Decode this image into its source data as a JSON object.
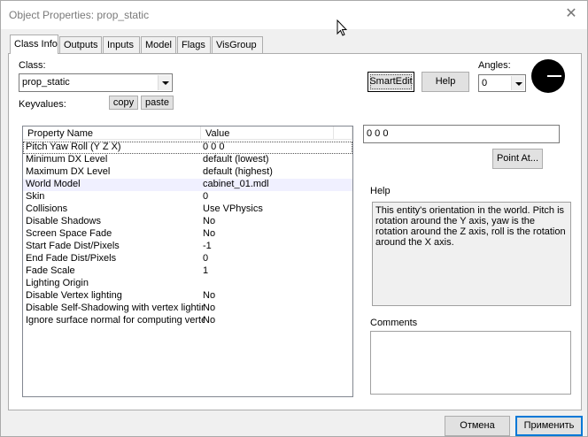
{
  "window": {
    "title": "Object Properties: prop_static",
    "close_glyph": "✕"
  },
  "tabs": [
    {
      "label": "Class Info",
      "active": true
    },
    {
      "label": "Outputs"
    },
    {
      "label": "Inputs"
    },
    {
      "label": "Model"
    },
    {
      "label": "Flags"
    },
    {
      "label": "VisGroup"
    }
  ],
  "class_info": {
    "class_label": "Class:",
    "class_value": "prop_static",
    "keyvalues_label": "Keyvalues:",
    "copy_label": "copy",
    "paste_label": "paste",
    "smartedit_label": "SmartEdit",
    "help_label": "Help",
    "angles_label": "Angles:",
    "angles_value": "0",
    "columns": [
      "Property Name",
      "Value"
    ],
    "properties": [
      {
        "name": "Pitch Yaw Roll (Y Z X)",
        "value": "0 0 0"
      },
      {
        "name": "Minimum DX Level",
        "value": "default (lowest)"
      },
      {
        "name": "Maximum DX Level",
        "value": "default (highest)"
      },
      {
        "name": "World Model",
        "value": "cabinet_01.mdl"
      },
      {
        "name": "Skin",
        "value": "0"
      },
      {
        "name": "Collisions",
        "value": "Use VPhysics"
      },
      {
        "name": "Disable Shadows",
        "value": "No"
      },
      {
        "name": "Screen Space Fade",
        "value": "No"
      },
      {
        "name": "Start Fade Dist/Pixels",
        "value": "-1"
      },
      {
        "name": "End Fade Dist/Pixels",
        "value": "0"
      },
      {
        "name": "Fade Scale",
        "value": "1"
      },
      {
        "name": "Lighting Origin",
        "value": ""
      },
      {
        "name": "Disable Vertex lighting",
        "value": "No"
      },
      {
        "name": "Disable Self-Shadowing with vertex lighting",
        "value": "No"
      },
      {
        "name": "Ignore surface normal for computing vertex lighting",
        "value": "No"
      }
    ],
    "value_field": "0 0 0",
    "point_at_label": "Point At...",
    "help_heading": "Help",
    "help_text": "This entity's orientation in the world. Pitch is rotation around the Y axis, yaw is the rotation around the Z axis, roll is the rotation around the X axis.",
    "comments_heading": "Comments"
  },
  "footer": {
    "cancel_label": "Отмена",
    "apply_label": "Применить"
  }
}
